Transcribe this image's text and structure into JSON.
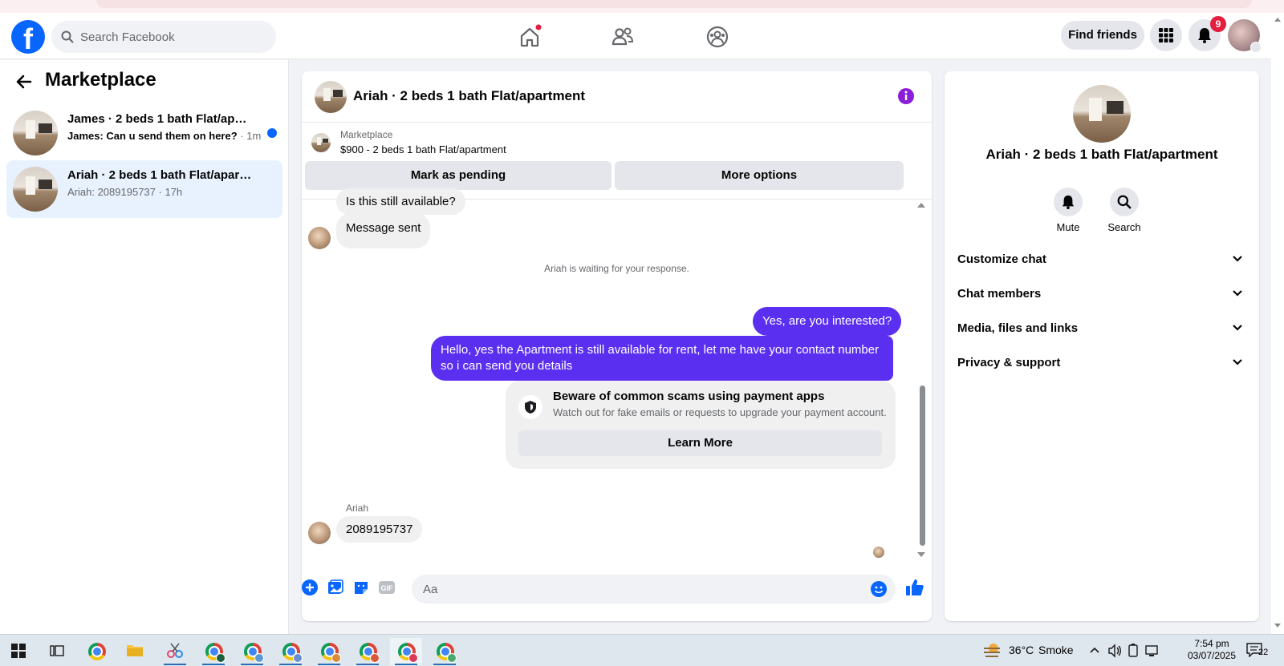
{
  "topnav": {
    "logo": "f",
    "search_placeholder": "Search Facebook",
    "find_friends": "Find friends",
    "notification_count": "9",
    "icons": [
      "home-icon",
      "friends-icon",
      "groups-icon",
      "menu-grid-icon",
      "bell-icon"
    ]
  },
  "sidebar": {
    "title": "Marketplace",
    "conversations": [
      {
        "name": "James · 2 beds 1 bath Flat/apartment",
        "sender": "James: ",
        "preview": "Can u send them on here?",
        "time": " · 1m",
        "unread": true
      },
      {
        "name": "Ariah · 2 beds 1 bath Flat/apartment",
        "sender": "Ariah: ",
        "preview": "2089195737",
        "time": " · 17h",
        "unread": false
      }
    ]
  },
  "chat": {
    "title": "Ariah · 2 beds 1 bath Flat/apartment",
    "listing_source": "Marketplace",
    "listing_title": "$900 - 2 beds 1 bath Flat/apartment",
    "mark_pending": "Mark as pending",
    "more_options": "More options",
    "messages": {
      "partial": "Is this still available?",
      "in_1": "Message sent",
      "waiting": "Ariah is waiting for your response.",
      "out_1": "Yes, are you interested?",
      "out_2": "Hello, yes the Apartment is still available for rent, let me have your contact number so i can send you details",
      "scam_title": "Beware of common scams using payment apps",
      "scam_sub": "Watch out for fake emails or requests to upgrade your payment account.",
      "learn_more": "Learn More",
      "sender_name": "Ariah",
      "in_2": "2089195737"
    },
    "composer_placeholder": "Aa"
  },
  "info_panel": {
    "title": "Ariah · 2 beds 1 bath Flat/apartment",
    "mute": "Mute",
    "search": "Search",
    "sections": [
      "Customize chat",
      "Chat members",
      "Media, files and links",
      "Privacy & support"
    ]
  },
  "taskbar": {
    "weather_temp": "36°C",
    "weather_desc": "Smoke",
    "time": "7:54 pm",
    "date": "03/07/2025",
    "notif_count": "22"
  },
  "colors": {
    "brand": "#0866ff",
    "outgoing_bubble": "#5b2ff0",
    "badge": "#e41e3f"
  }
}
